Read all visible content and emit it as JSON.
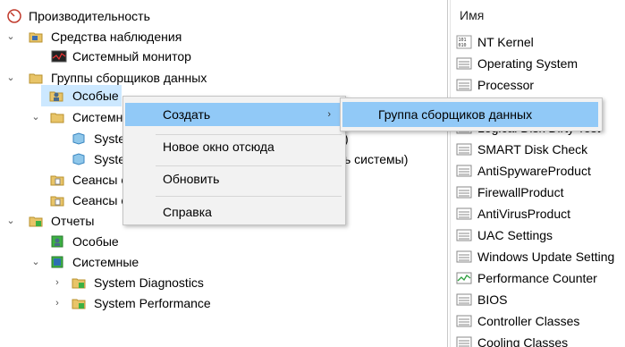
{
  "tree": {
    "root": "Производительность",
    "monitoring_tools": "Средства наблюдения",
    "system_monitor": "Системный монитор",
    "collector_sets": "Группы сборщиков данных",
    "user_defined": "Особые",
    "system": "Системн",
    "sys_item1": "Syste",
    "sys_item2": "Syste",
    "sys_item2_suffix": "ь системы)",
    "sys_item1_suffix": ")",
    "sessions1": "Сеансы с",
    "sessions2": "Сеансы с",
    "reports": "Отчеты",
    "reports_user": "Особые",
    "reports_system": "Системные",
    "diag": "System Diagnostics",
    "perf": "System Performance"
  },
  "right_pane": {
    "header": "Имя",
    "items": [
      "NT Kernel",
      "Operating System",
      "Processor",
      "Logical Disk Dirty Test",
      "SMART Disk Check",
      "AntiSpywareProduct",
      "FirewallProduct",
      "AntiVirusProduct",
      "UAC Settings",
      "Windows Update Setting",
      "Performance Counter",
      "BIOS",
      "Controller Classes",
      "Cooling Classes"
    ]
  },
  "context_menu": {
    "create": "Создать",
    "new_window": "Новое окно отсюда",
    "refresh": "Обновить",
    "help": "Справка"
  },
  "submenu": {
    "collector_set": "Группа сборщиков данных"
  }
}
